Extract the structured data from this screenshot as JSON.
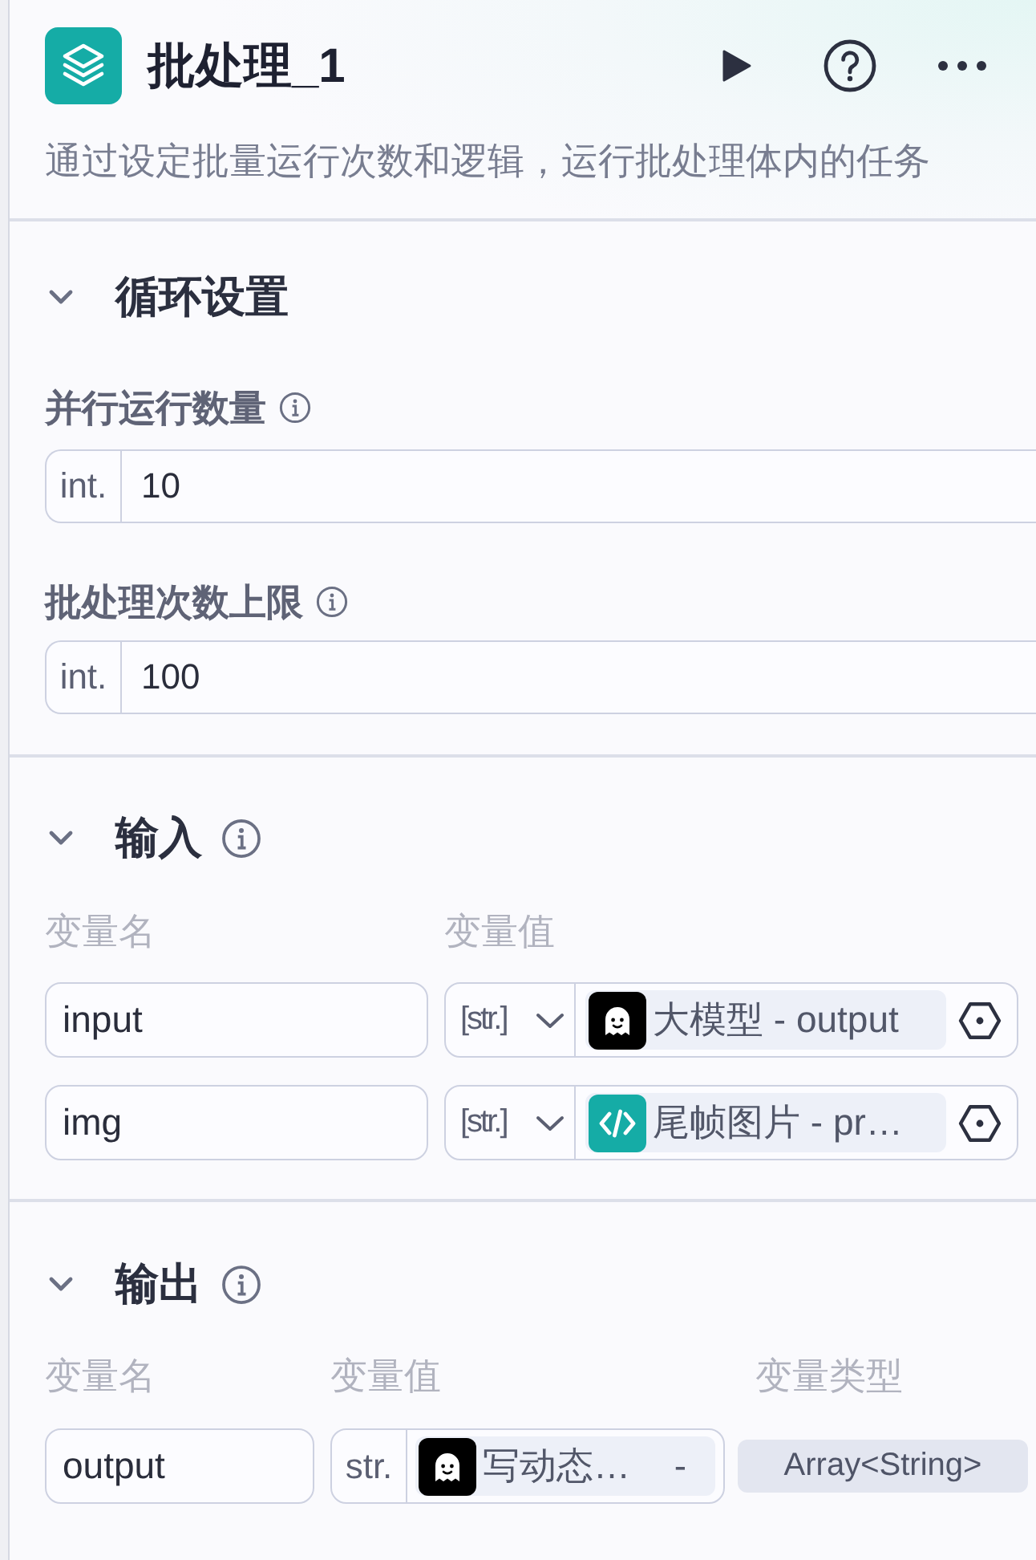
{
  "node": {
    "title": "批处理_1",
    "description": "通过设定批量运行次数和逻辑，运行批处理体内的任务"
  },
  "sections": [
    {
      "kind": "loop_settings",
      "title": "循环设置",
      "expanded": true,
      "info_icon": false,
      "fields": [
        {
          "label": "并行运行数量",
          "info_icon": true,
          "prefix": "int.",
          "value": "10"
        },
        {
          "label": "批处理次数上限",
          "info_icon": true,
          "prefix": "int.",
          "value": "100"
        }
      ]
    },
    {
      "kind": "inputs",
      "title": "输入",
      "expanded": true,
      "info_icon": true,
      "columns": [
        "变量名",
        "变量值"
      ],
      "rows": [
        {
          "name": "input",
          "value_type": "[str.]",
          "reference": {
            "kind": "llm",
            "text": "大模型 - output"
          }
        },
        {
          "name": "img",
          "value_type": "[str.]",
          "reference": {
            "kind": "code",
            "text": "尾帧图片 - pr…"
          }
        }
      ]
    },
    {
      "kind": "outputs",
      "title": "输出",
      "expanded": true,
      "info_icon": true,
      "columns": [
        "变量名",
        "变量值",
        "变量类型"
      ],
      "rows": [
        {
          "name": "output",
          "value_type": "str.",
          "reference": {
            "kind": "llm",
            "text": "写动态…",
            "suffix": "-"
          },
          "type": "Array<String>"
        }
      ]
    }
  ]
}
